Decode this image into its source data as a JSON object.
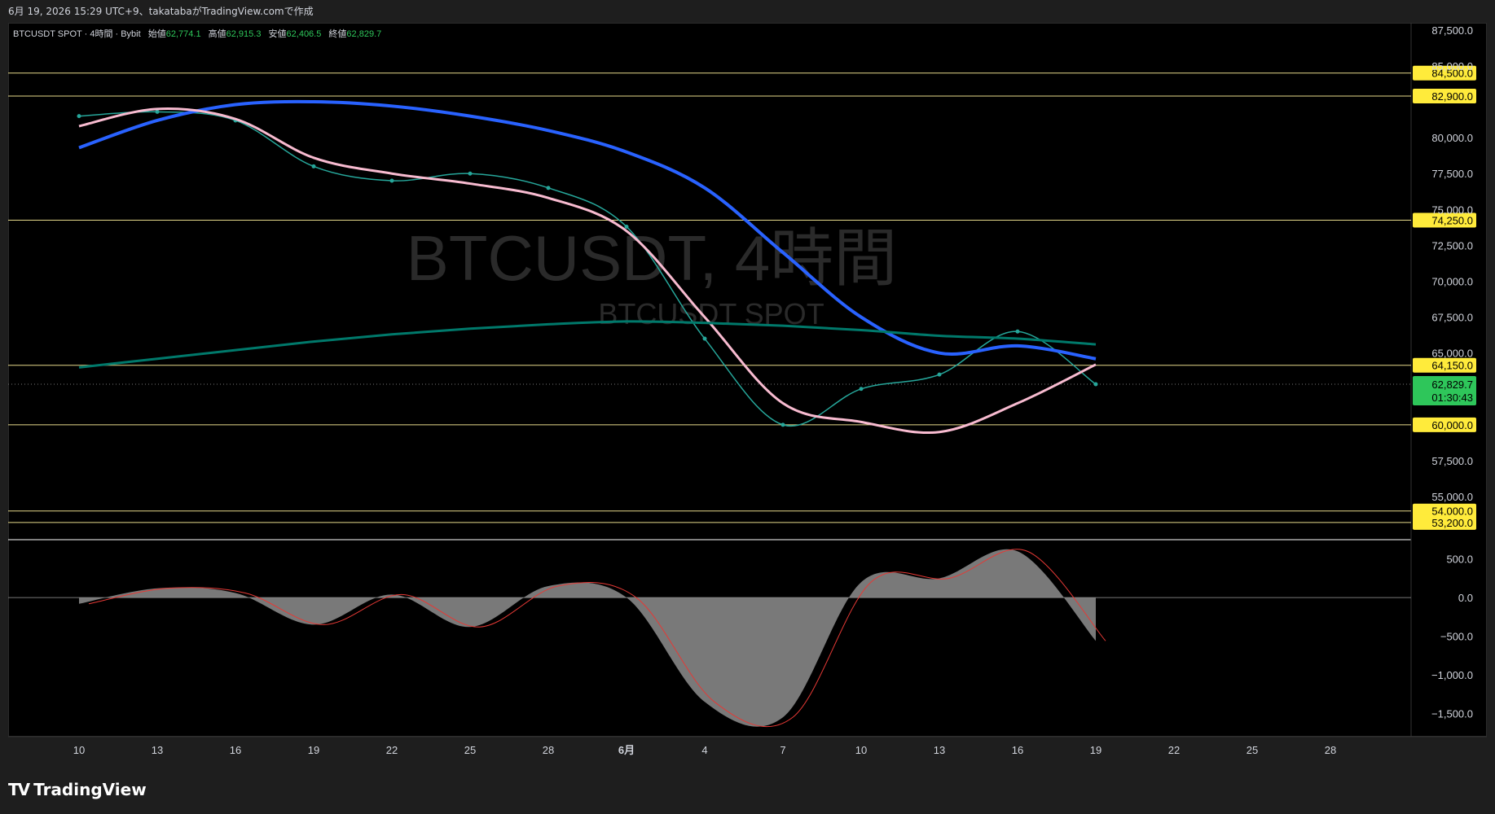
{
  "header": {
    "caption": "6月 19, 2026 15:29 UTC+9、takatabaがTradingView.comで作成"
  },
  "legend": {
    "symbol": "BTCUSDT SPOT · 4時間 · Bybit",
    "o_label": "始値",
    "o_value": "62,774.1",
    "h_label": "高値",
    "h_value": "62,915.3",
    "l_label": "安値",
    "l_value": "62,406.5",
    "c_label": "終値",
    "c_value": "62,829.7"
  },
  "watermark": {
    "big": "BTCUSDT, 4時間",
    "small": "BTCUSDT SPOT"
  },
  "price_axis": {
    "ticks": [
      "87,500.0",
      "85,000.0",
      "80,000.0",
      "77,500.0",
      "75,000.0",
      "72,500.0",
      "70,000.0",
      "67,500.0",
      "65,000.0",
      "57,500.0",
      "55,000.0"
    ],
    "hlines": [
      "84,500.0",
      "82,900.0",
      "74,250.0",
      "64,150.0",
      "60,000.0",
      "54,000.0",
      "53,200.0"
    ],
    "last_price": "62,829.7",
    "countdown": "01:30:43"
  },
  "osc_axis": {
    "ticks": [
      "500.0",
      "0.0",
      "−500.0",
      "−1,000.0",
      "−1,500.0"
    ]
  },
  "time_axis": {
    "labels": [
      "10",
      "13",
      "16",
      "19",
      "22",
      "25",
      "28",
      "6月",
      "4",
      "7",
      "10",
      "13",
      "16",
      "19",
      "22",
      "25",
      "28"
    ]
  },
  "footer": {
    "brand": "TradingView"
  },
  "colors": {
    "hline": "#e6d98a",
    "hline_label_bg": "#ffeb3b",
    "last_price_bg": "#2ec65a",
    "candle_up": "#26a69a",
    "ma_blue": "#2962ff",
    "ma_pink": "#f8bbd0",
    "ma_green": "#4caf50",
    "ma_teal": "#00796b",
    "ma_white": "#ffffff",
    "bb": "#4a90e2",
    "purple": "#ba68c8",
    "histogram": "#8e8e8e",
    "signal": "#e53935"
  },
  "chart_data": [
    {
      "type": "line",
      "title": "BTCUSDT SPOT · 4時間 · Bybit",
      "ohlc_last": {
        "open": 62774.1,
        "high": 62915.3,
        "low": 62406.5,
        "close": 62829.7
      },
      "x": [
        "10",
        "13",
        "16",
        "19",
        "22",
        "25",
        "28",
        "6月",
        "4",
        "7",
        "10",
        "13",
        "16",
        "19"
      ],
      "series": [
        {
          "values": [
            81500,
            81800,
            81200,
            78000,
            77000,
            77500,
            76500,
            73800,
            66000,
            60000,
            62500,
            63500,
            66500,
            62829.7
          ]
        },
        {
          "values": [
            79300,
            81200,
            82300,
            82500,
            82200,
            81500,
            80500,
            79000,
            76500,
            72000,
            67500,
            65000,
            65500,
            64600
          ]
        },
        {
          "values": [
            80800,
            82000,
            81300,
            78600,
            77500,
            76800,
            75800,
            73500,
            67500,
            61500,
            60200,
            59500,
            61500,
            64200
          ]
        },
        {
          "values": [
            64000,
            64600,
            65200,
            65800,
            66300,
            66700,
            67000,
            67200,
            67100,
            66900,
            66600,
            66200,
            66000,
            65600
          ]
        }
      ],
      "horizontal_levels": [
        84500,
        82900,
        74250,
        64150,
        60000,
        54000,
        53200
      ],
      "ylim": [
        52000,
        88000
      ]
    },
    {
      "type": "area",
      "x": [
        "10",
        "13",
        "16",
        "19",
        "22",
        "25",
        "28",
        "6月",
        "4",
        "7",
        "10",
        "13",
        "16",
        "19"
      ],
      "series": [
        {
          "values": [
            -80,
            120,
            60,
            -350,
            40,
            -380,
            150,
            0,
            -1350,
            -1550,
            200,
            250,
            600,
            -560
          ]
        }
      ],
      "ylim": [
        -1800,
        750
      ]
    }
  ]
}
